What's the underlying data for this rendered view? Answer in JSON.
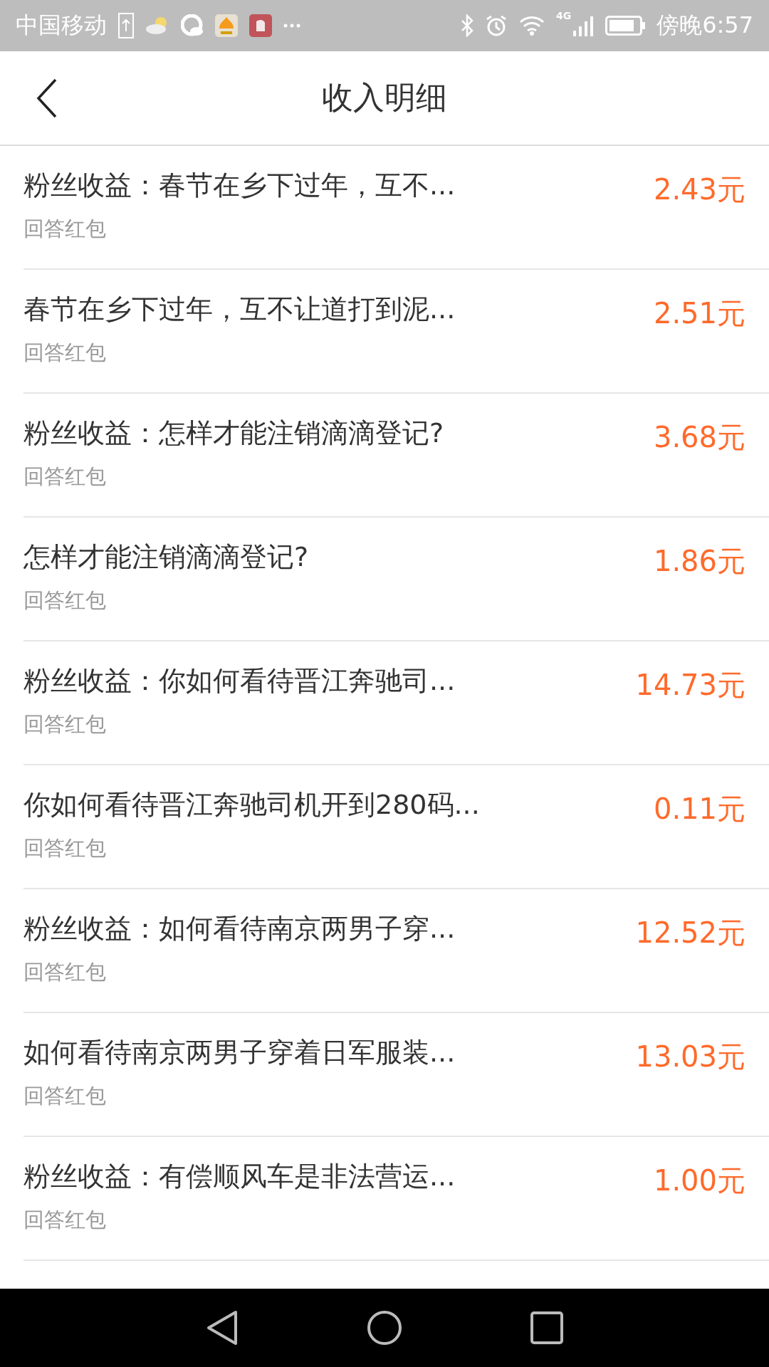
{
  "status_bar": {
    "carrier": "中国移动",
    "network": "4G",
    "time": "傍晚6:57"
  },
  "header": {
    "title": "收入明细"
  },
  "rows": [
    {
      "title": "粉丝收益：春节在乡下过年，互不...",
      "subtitle": "回答红包",
      "amount": "2.43元"
    },
    {
      "title": "春节在乡下过年，互不让道打到泥...",
      "subtitle": "回答红包",
      "amount": "2.51元"
    },
    {
      "title": "粉丝收益：怎样才能注销滴滴登记?",
      "subtitle": "回答红包",
      "amount": "3.68元"
    },
    {
      "title": "怎样才能注销滴滴登记?",
      "subtitle": "回答红包",
      "amount": "1.86元"
    },
    {
      "title": "粉丝收益：你如何看待晋江奔驰司...",
      "subtitle": "回答红包",
      "amount": "14.73元"
    },
    {
      "title": "你如何看待晋江奔驰司机开到280码...",
      "subtitle": "回答红包",
      "amount": "0.11元"
    },
    {
      "title": "粉丝收益：如何看待南京两男子穿...",
      "subtitle": "回答红包",
      "amount": "12.52元"
    },
    {
      "title": "如何看待南京两男子穿着日军服装...",
      "subtitle": "回答红包",
      "amount": "13.03元"
    },
    {
      "title": "粉丝收益：有偿顺风车是非法营运...",
      "subtitle": "回答红包",
      "amount": "1.00元"
    }
  ]
}
